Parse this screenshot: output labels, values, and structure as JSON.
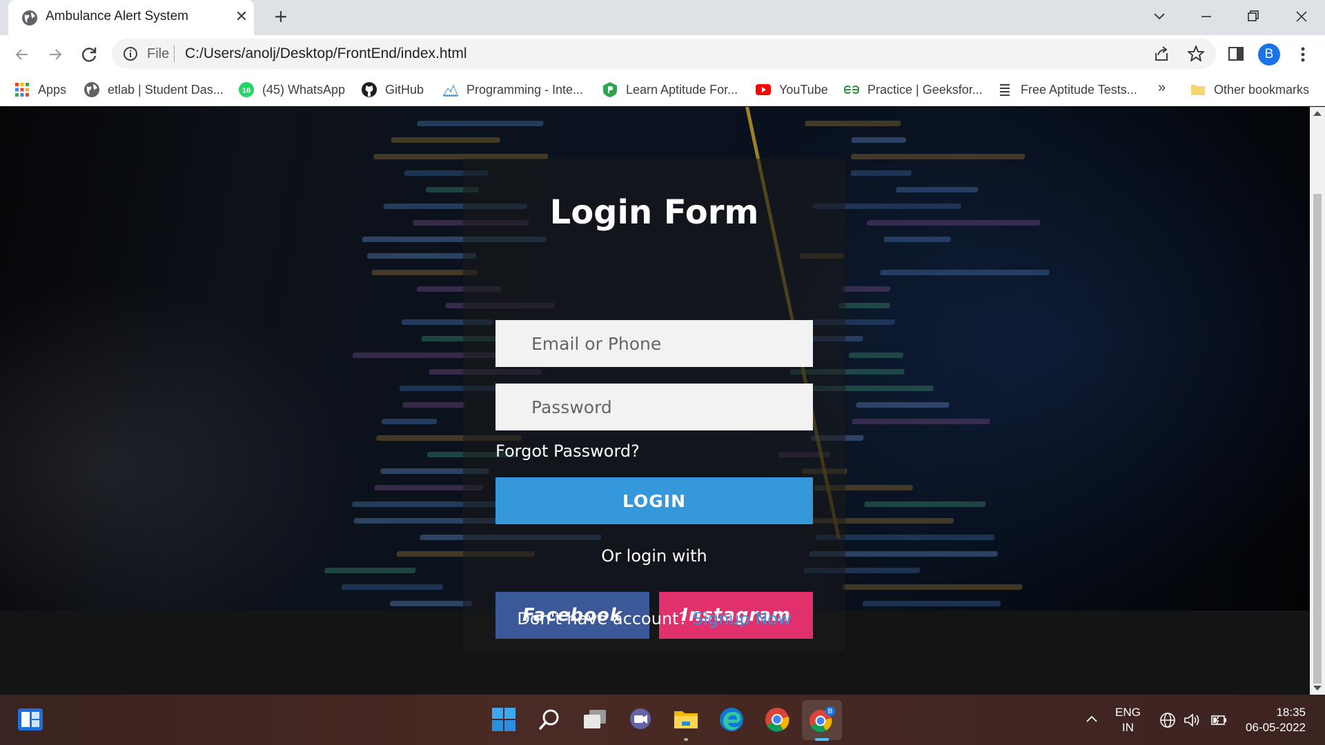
{
  "browser": {
    "tab_title": "Ambulance Alert System",
    "scheme": "File",
    "url": "C:/Users/anolj/Desktop/FrontEnd/index.html",
    "profile_initial": "B"
  },
  "bookmarks": [
    {
      "label": "Apps",
      "icon": "apps-grid-icon"
    },
    {
      "label": "etlab | Student Das...",
      "icon": "globe-icon"
    },
    {
      "label": "(45) WhatsApp",
      "icon": "whatsapp-icon",
      "badge": "16"
    },
    {
      "label": "GitHub",
      "icon": "github-icon"
    },
    {
      "label": "Programming - Inte...",
      "icon": "programming-icon"
    },
    {
      "label": "Learn Aptitude For...",
      "icon": "aptitude-shield-icon"
    },
    {
      "label": "YouTube",
      "icon": "youtube-icon"
    },
    {
      "label": "Practice | Geeksfor...",
      "icon": "geeksforgeeks-icon"
    },
    {
      "label": "Free Aptitude Tests...",
      "icon": "list-icon"
    }
  ],
  "bookmarks_more": "»",
  "other_bookmarks": "Other bookmarks",
  "login": {
    "title": "Login Form",
    "email_placeholder": "Email or Phone",
    "password_placeholder": "Password",
    "forgot": "Forgot Password?",
    "login_button": "LOGIN",
    "or_text": "Or login with",
    "facebook": "Facebook",
    "instagram": "Instagram",
    "no_account": "Don't have account?",
    "signup": "Signup Now"
  },
  "colors": {
    "login_blue": "#3498db",
    "facebook": "#3b5998",
    "instagram": "#e1306c"
  },
  "taskbar": {
    "lang_line1": "ENG",
    "lang_line2": "IN",
    "time": "18:35",
    "date": "06-05-2022",
    "chrome_profile_badge": "B"
  }
}
